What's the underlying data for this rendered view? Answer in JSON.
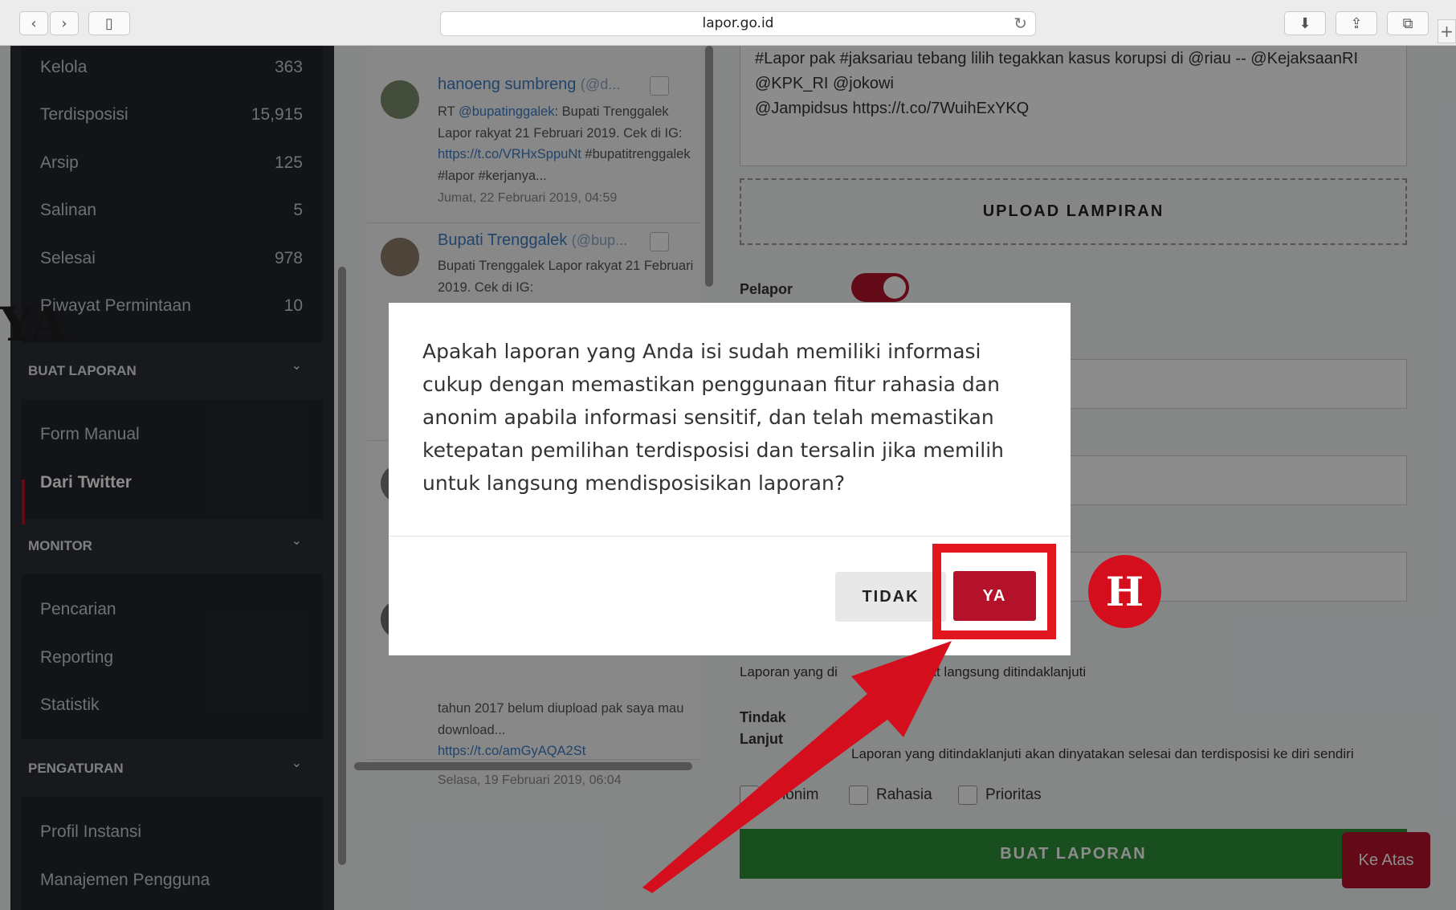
{
  "browser": {
    "url": "lapor.go.id",
    "back_icon": "‹",
    "forward_icon": "›",
    "sidebar_icon": "▯",
    "reload_icon": "↻",
    "download_icon": "⬇",
    "share_icon": "⇪",
    "tabs_icon": "⧉",
    "new_tab_icon": "+"
  },
  "sidebar": {
    "counts": [
      {
        "label": "Kelola",
        "count": "363"
      },
      {
        "label": "Terdisposisi",
        "count": "15,915"
      },
      {
        "label": "Arsip",
        "count": "125"
      },
      {
        "label": "Salinan",
        "count": "5"
      },
      {
        "label": "Selesai",
        "count": "978"
      },
      {
        "label": "Riwayat Permintaan",
        "count": "10"
      }
    ],
    "sections": [
      {
        "title": "BUAT LAPORAN",
        "items": [
          "Form Manual",
          "Dari Twitter"
        ]
      },
      {
        "title": "MONITOR",
        "items": [
          "Pencarian",
          "Reporting",
          "Statistik"
        ]
      },
      {
        "title": "PENGATURAN",
        "items": [
          "Profil Instansi",
          "Manajemen Pengguna"
        ]
      }
    ],
    "active_item": "Dari Twitter",
    "chevron": "⌄"
  },
  "tweets": [
    {
      "name": "hanoeng sumbreng",
      "handle": "(@d...",
      "text_pre": "RT ",
      "mention": "@bupatinggalek",
      "text_mid": ": Bupati Trenggalek Lapor rakyat 21 Februari 2019. Cek di IG: ",
      "link": "https://t.co/VRHxSppuNt",
      "text_post": " #bupatitrenggalek #lapor #kerjanya...",
      "date": "Jumat, 22 Februari 2019, 04:59"
    },
    {
      "name": "Bupati Trenggalek",
      "handle": "(@bup...",
      "text": "Bupati Trenggalek Lapor rakyat 21 Februari 2019. Cek di IG:"
    },
    {
      "text": "tahun 2017 belum diupload pak saya mau download...",
      "link": "https://t.co/amGyAQA2St",
      "date": "Selasa, 19 Februari 2019, 06:04"
    }
  ],
  "form": {
    "tweet_text_line1": "#Lapor pak #jaksariau tebang lilih tegakkan kasus korupsi di @riau -- @KejaksaanRI",
    "tweet_text_line2": "@KPK_RI @jokowi",
    "tweet_text_line3": "@Jampidsus https://t.co/7WuihExYKQ",
    "upload_label": "UPLOAD LAMPIRAN",
    "pelapor_label": "Pelapor",
    "pelapor_toggle_on": true,
    "info_text_1a": "Laporan yang di",
    "info_text_1b": "k dapat langsung ditindaklanjuti",
    "tindak_label_1": "Tindak",
    "tindak_label_2": "Lanjut",
    "info_text_2": "Laporan yang ditindaklanjuti akan dinyatakan selesai dan terdisposisi ke diri sendiri",
    "checkboxes": [
      "Anonim",
      "Rahasia",
      "Prioritas"
    ],
    "submit_label": "BUAT LAPORAN",
    "scroll_top_label": "Ke Atas"
  },
  "modal": {
    "message": "Apakah laporan yang Anda isi sudah memiliki informasi cukup dengan memastikan penggunaan fitur rahasia dan anonim apabila informasi sensitif, dan telah memastikan ketepatan pemilihan terdisposisi dan tersalin jika memilih untuk langsung mendisposisikan laporan?",
    "cancel_label": "TIDAK",
    "confirm_label": "YA"
  },
  "annotation": {
    "badge_letter": "H",
    "cut_text": "YA",
    "highlight_color": "#e2161f"
  },
  "colors": {
    "brand_red": "#b4122a",
    "submit_green": "#2f8f3a",
    "sidebar_bg": "#2b2f33"
  }
}
